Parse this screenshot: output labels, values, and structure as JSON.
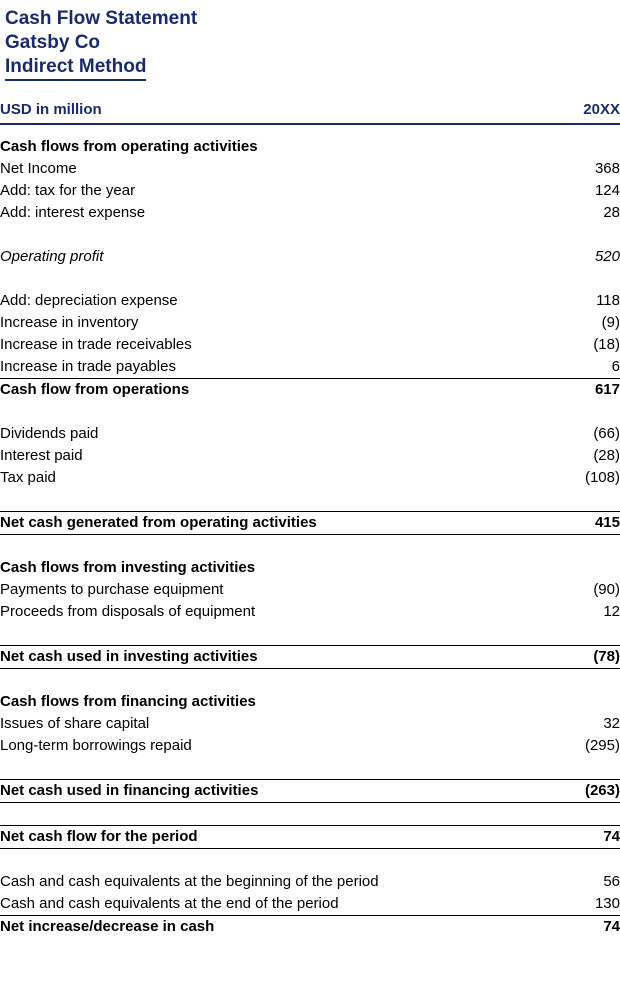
{
  "document": {
    "title_lines": [
      "Cash Flow Statement",
      "Gatsby Co",
      "Indirect Method"
    ],
    "column_header": {
      "label": "USD in million",
      "period": "20XX"
    }
  },
  "statement": {
    "operating": {
      "heading": "Cash flows from operating activities",
      "items": [
        {
          "label": "Net Income",
          "value": "368"
        },
        {
          "label": "Add: tax for the year",
          "value": "124"
        },
        {
          "label": "Add: interest expense",
          "value": "28"
        }
      ],
      "operating_profit": {
        "label": "Operating profit",
        "value": "520"
      },
      "adjustments": [
        {
          "label": "Add: depreciation expense",
          "value": "118"
        },
        {
          "label": "Increase in inventory",
          "value": "(9)"
        },
        {
          "label": "Increase in trade receivables",
          "value": "(18)"
        },
        {
          "label": "Increase in trade payables",
          "value": "6"
        }
      ],
      "cash_flow_from_operations": {
        "label": "Cash flow from operations",
        "value": "617"
      },
      "payments": [
        {
          "label": "Dividends paid",
          "value": "(66)"
        },
        {
          "label": "Interest paid",
          "value": "(28)"
        },
        {
          "label": "Tax paid",
          "value": "(108)"
        }
      ],
      "net_total": {
        "label": "Net cash generated from operating activities",
        "value": "415"
      }
    },
    "investing": {
      "heading": "Cash flows from investing activities",
      "items": [
        {
          "label": "Payments to purchase equipment",
          "value": "(90)"
        },
        {
          "label": "Proceeds from disposals of equipment",
          "value": "12"
        }
      ],
      "net_total": {
        "label": "Net cash used in investing activities",
        "value": "(78)"
      }
    },
    "financing": {
      "heading": "Cash flows from financing activities",
      "items": [
        {
          "label": "Issues of share capital",
          "value": "32"
        },
        {
          "label": "Long-term borrowings repaid",
          "value": "(295)"
        }
      ],
      "net_total": {
        "label": "Net cash used in financing activities",
        "value": "(263)"
      }
    },
    "net_cash_flow": {
      "label": "Net cash flow for the period",
      "value": "74"
    },
    "reconciliation": {
      "items": [
        {
          "label": "Cash and cash equivalents at the beginning of the period",
          "value": "56"
        },
        {
          "label": "Cash and cash equivalents at the end of the period",
          "value": "130"
        }
      ],
      "net_total": {
        "label": "Net increase/decrease in cash",
        "value": "74"
      }
    }
  },
  "colors": {
    "heading_navy": "#1a2a6b",
    "body_black": "#000000",
    "background": "#ffffff"
  }
}
